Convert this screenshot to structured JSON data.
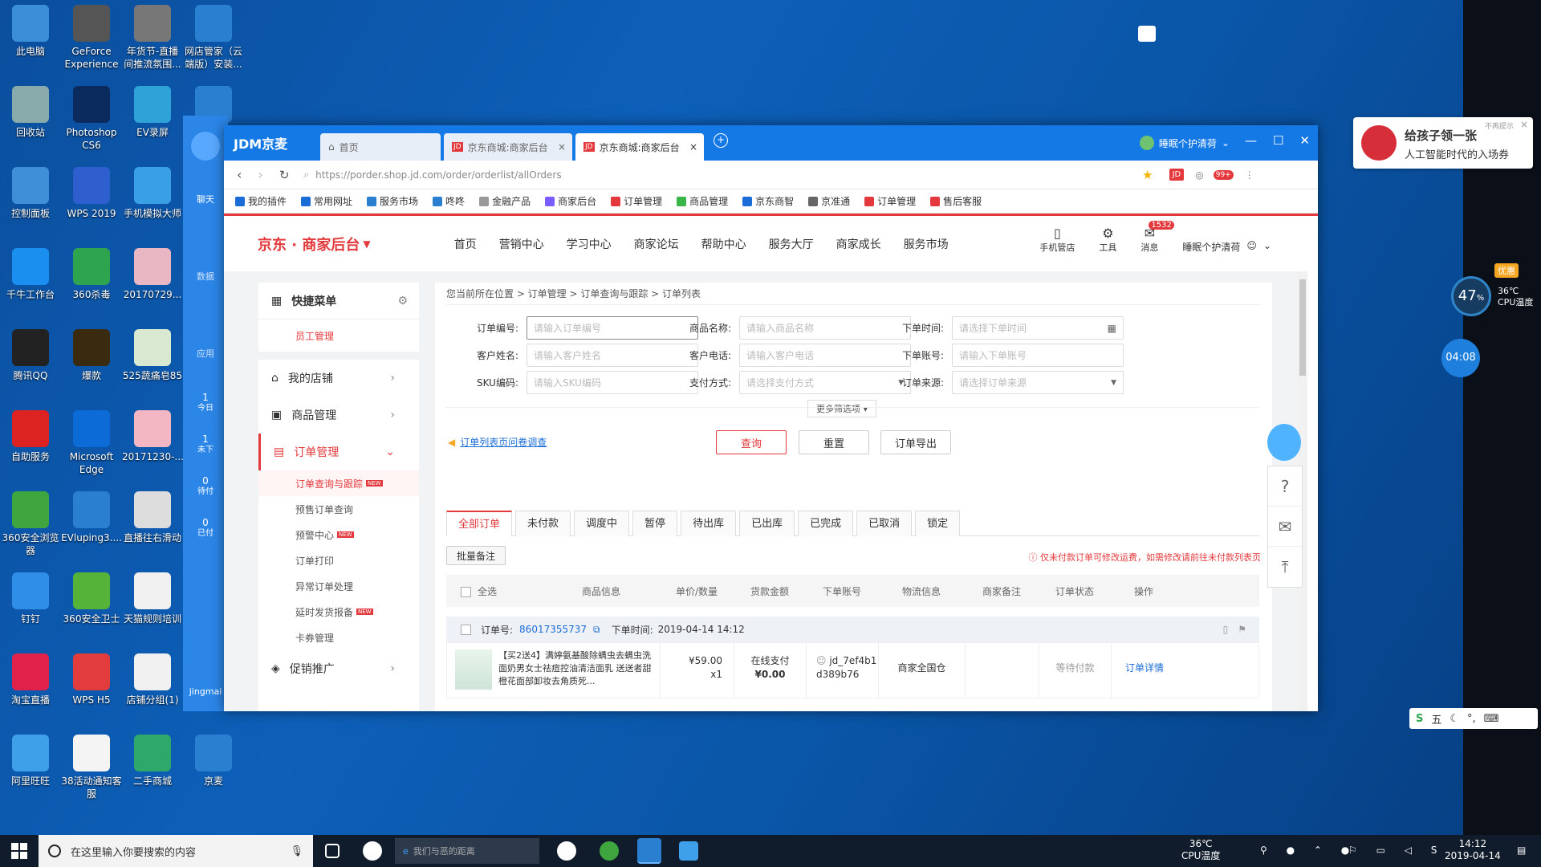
{
  "desktop_icons": [
    {
      "label": "此电脑",
      "color": "#3b8fd9"
    },
    {
      "label": "GeForce Experience",
      "color": "#555"
    },
    {
      "label": "年货节-直播间推流氛围...",
      "color": "#777"
    },
    {
      "label": "网店管家（云端版）安装...",
      "color": "#2a7fd0"
    },
    {
      "label": "回收站",
      "color": "#8aa"
    },
    {
      "label": "Photoshop CS6",
      "color": "#0b2a5e"
    },
    {
      "label": "EV录屏",
      "color": "#2fa2d7"
    },
    {
      "label": "",
      "color": "#2a7fd0"
    },
    {
      "label": "控制面板",
      "color": "#3f8fd8"
    },
    {
      "label": "WPS 2019",
      "color": "#2f5fcf"
    },
    {
      "label": "手机模拟大师",
      "color": "#3aa0e6"
    },
    {
      "label": "千牛工作台",
      "color": "#1b8ff0"
    },
    {
      "label": "360杀毒",
      "color": "#2ea44f"
    },
    {
      "label": "20170729...",
      "color": "#e9b6c4"
    },
    {
      "label": "腾讯QQ",
      "color": "#222"
    },
    {
      "label": "爆款",
      "color": "#3a2a10"
    },
    {
      "label": "525蔬痛皂85",
      "color": "#d9e8d0"
    },
    {
      "label": "自助服务",
      "color": "#d22"
    },
    {
      "label": "Microsoft Edge",
      "color": "#0c6bd6"
    },
    {
      "label": "20171230-...",
      "color": "#f2b7c2"
    },
    {
      "label": "360安全浏览器",
      "color": "#3fa63f"
    },
    {
      "label": "EVluping3....",
      "color": "#2a7fd0"
    },
    {
      "label": "直播往右滑动",
      "color": "#ddd"
    },
    {
      "label": "钉钉",
      "color": "#2f8fe8"
    },
    {
      "label": "360安全卫士",
      "color": "#56b33a"
    },
    {
      "label": "天猫规则培训",
      "color": "#f0f0f0"
    },
    {
      "label": "淘宝直播",
      "color": "#e0224a"
    },
    {
      "label": "WPS H5",
      "color": "#e23c3c"
    },
    {
      "label": "店铺分组(1)",
      "color": "#f0f0f0"
    },
    {
      "label": "阿里旺旺",
      "color": "#3da0e8"
    },
    {
      "label": "38活动通知客服",
      "color": "#f4f4f4"
    },
    {
      "label": "二手商城",
      "color": "#2fa86b"
    },
    {
      "label": "京麦",
      "color": "#2a7fd0"
    }
  ],
  "left_panel": {
    "items": [
      "聊天",
      "数据",
      "应用"
    ],
    "stats": [
      {
        "num": "1",
        "label": "今日"
      },
      {
        "num": "1",
        "label": "未下"
      },
      {
        "num": "0",
        "label": "待付"
      },
      {
        "num": "0",
        "label": "已付"
      }
    ],
    "user": "jingmai"
  },
  "browser": {
    "app_name": "JDM京麦",
    "tabs": [
      {
        "label": "首页"
      },
      {
        "label": "京东商城:商家后台"
      },
      {
        "label": "京东商城:商家后台"
      }
    ],
    "account": "睡眠个护清荷",
    "url": "https://porder.shop.jd.com/order/orderlist/allOrders",
    "badge": "99+",
    "bookmarks": [
      "我的插件",
      "常用网址",
      "服务市场",
      "咚咚",
      "金融产品",
      "商家后台",
      "订单管理",
      "商品管理",
      "京东商智",
      "京准通",
      "订单管理",
      "售后客服"
    ]
  },
  "jd": {
    "logo": "京东 · 商家后台",
    "nav": [
      "首页",
      "营销中心",
      "学习中心",
      "商家论坛",
      "帮助中心",
      "服务大厅",
      "商家成长",
      "服务市场"
    ],
    "right": {
      "phone": "手机管店",
      "tools": "工具",
      "messages": "消息",
      "msg_count": "1532",
      "account": "睡眠个护清荷"
    }
  },
  "sidebar": {
    "quick_menu": "快捷菜单",
    "staff": "员工管理",
    "groups": [
      {
        "label": "我的店铺"
      },
      {
        "label": "商品管理"
      },
      {
        "label": "订单管理"
      }
    ],
    "subitems": [
      {
        "label": "订单查询与跟踪",
        "new": "NEW"
      },
      {
        "label": "预售订单查询",
        "new": ""
      },
      {
        "label": "预警中心",
        "new": "NEW"
      },
      {
        "label": "订单打印",
        "new": ""
      },
      {
        "label": "异常订单处理",
        "new": ""
      },
      {
        "label": "延时发货报备",
        "new": "NEW"
      },
      {
        "label": "卡券管理",
        "new": ""
      }
    ],
    "promo": "促销推广"
  },
  "main": {
    "breadcrumb": "您当前所在位置 > 订单管理 > 订单查询与跟踪 > 订单列表",
    "filters": [
      {
        "label": "订单编号:",
        "placeholder": "请输入订单编号"
      },
      {
        "label": "商品名称:",
        "placeholder": "请输入商品名称"
      },
      {
        "label": "下单时间:",
        "placeholder": "请选择下单时间"
      },
      {
        "label": "客户姓名:",
        "placeholder": "请输入客户姓名"
      },
      {
        "label": "客户电话:",
        "placeholder": "请输入客户电话"
      },
      {
        "label": "下单账号:",
        "placeholder": "请输入下单账号"
      },
      {
        "label": "SKU编码:",
        "placeholder": "请输入SKU编码"
      },
      {
        "label": "支付方式:",
        "placeholder": "请选择支付方式"
      },
      {
        "label": "订单来源:",
        "placeholder": "请选择订单来源"
      }
    ],
    "more_filters": "更多筛选项 ▾",
    "survey_link": "订单列表页问卷调查",
    "buttons": {
      "query": "查询",
      "reset": "重置",
      "export": "订单导出"
    },
    "order_tabs": [
      "全部订单",
      "未付款",
      "调度中",
      "暂停",
      "待出库",
      "已出库",
      "已完成",
      "已取消",
      "锁定"
    ],
    "batch_note": "批量备注",
    "notice": "仅未付款订单可修改运费，如需修改请前往未付款列表页",
    "columns": [
      "全选",
      "商品信息",
      "单价/数量",
      "货款金额",
      "下单账号",
      "物流信息",
      "商家备注",
      "订单状态",
      "操作"
    ],
    "order": {
      "label": "订单号:",
      "id": "86017355737",
      "time_label": "下单时间:",
      "time": "2019-04-14 14:12",
      "title": "【买2送4】满婷氨基酸除螨虫去螨虫洗面奶男女士祛痘控油清洁面乳 送送者甜橙花面部卸妆去角质死...",
      "price": "¥59.00",
      "qty": "x1",
      "pay": "在线支付",
      "amount": "¥0.00",
      "account": "jd_7ef4b1d389b76",
      "delivery": "商家全国仓",
      "status": "等待付款",
      "action": "订单详情"
    }
  },
  "widgets": {
    "notice_title": "给孩子领一张",
    "notice_sub": "人工智能时代的入场券",
    "no_remind": "不再提示",
    "cpu_pct": "47",
    "cpu_temp": "36℃",
    "cpu_label": "CPU温度",
    "timer": "04:08",
    "promo": "优惠"
  },
  "taskbar": {
    "search": "在这里输入你要搜索的内容",
    "app_search": "我们与恶的距离",
    "temp": "36℃",
    "temp_label": "CPU温度",
    "time": "14:12",
    "date": "2019-04-14",
    "ime": "五"
  }
}
